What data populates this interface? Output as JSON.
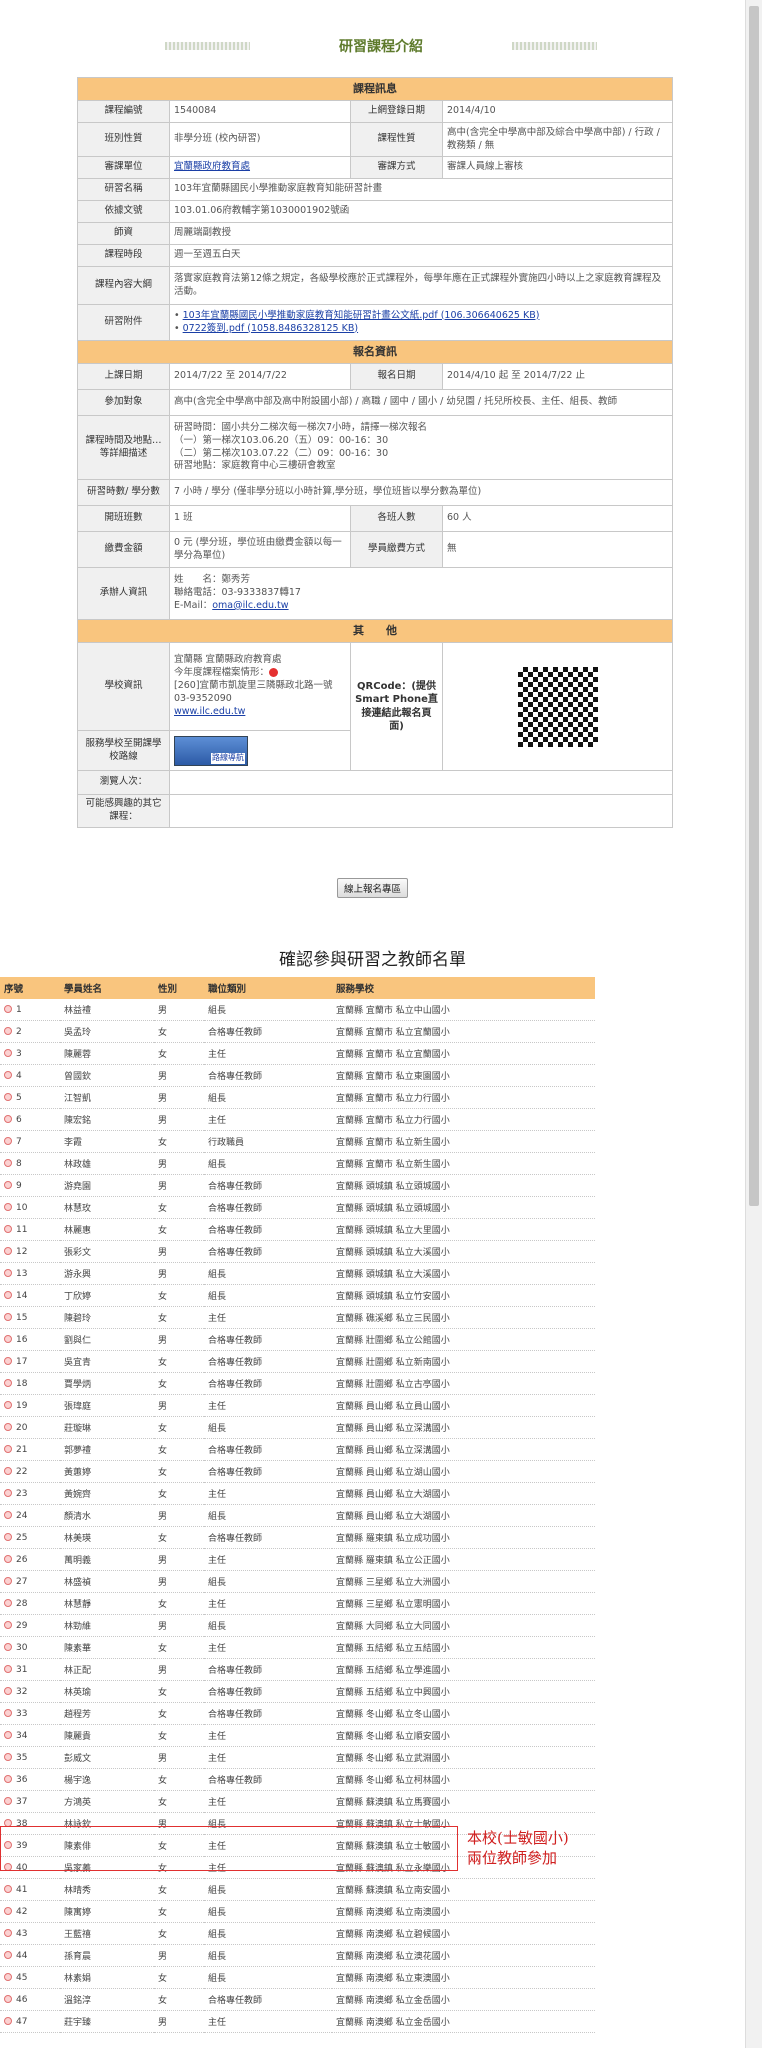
{
  "page": {
    "title": "研習課程介紹"
  },
  "sections": {
    "course": "課程訊息",
    "enroll": "報名資訊",
    "other": "其　　他"
  },
  "course": {
    "id_label": "課程編號",
    "id": "1540084",
    "listed_label": "上網登錄日期",
    "listed": "2014/4/10",
    "class_label": "班別性質",
    "class": "非學分班 (校內研習)",
    "nature_label": "課程性質",
    "nature": "高中(含完全中學高中部及綜合中學高中部) / 行政 / 教務類 / 無",
    "unit_label": "審課單位",
    "unit": "宜蘭縣政府教育處",
    "review_label": "審課方式",
    "review": "審課人員線上審核",
    "name_label": "研習名稱",
    "name": "103年宜蘭縣國民小學推動家庭教育知能研習計畫",
    "doc_label": "依據文號",
    "doc": "103.01.06府教輔字第1030001902號函",
    "teacher_label": "師資",
    "teacher": "周麗端副教授",
    "time_label": "課程時段",
    "time": "週一至週五白天",
    "content_label": "課程內容大綱",
    "content": "落實家庭教育法第12條之規定，各級學校應於正式課程外，每學年應在正式課程外實施四小時以上之家庭教育課程及活動。",
    "attach_label": "研習附件",
    "attachments": [
      "103年宜蘭縣國民小學推動家庭教育知能研習計畫公文紙.pdf (106.306640625 KB)",
      "0722簽到.pdf (1058.8486328125 KB)"
    ]
  },
  "enroll": {
    "date_label": "上課日期",
    "date": "2014/7/22 至 2014/7/22",
    "signup_label": "報名日期",
    "signup": "2014/4/10 起 至 2014/7/22 止",
    "target_label": "參加對象",
    "target": "高中(含完全中學高中部及高中附設國小部) / 高職 / 國中 / 國小 / 幼兒園 / 托兒所校長、主任、組長、教師",
    "place_label": "課程時間及地點…等詳細描述",
    "place_lines": [
      "研習時間：國小共分二梯次每一梯次7小時，請擇一梯次報名",
      "（一）第一梯次103.06.20（五）09：00-16：30",
      "（二）第二梯次103.07.22（二）09：00-16：30",
      "研習地點：家庭教育中心三樓研會教室"
    ],
    "hours_label": "研習時數/ 學分數",
    "hours": "7 小時 / 學分 (僅非學分班以小時計算,學分班，學位班皆以學分數為單位)",
    "classes_label": "開班班數",
    "classes": "1 班",
    "per_label": "各班人數",
    "per": "60 人",
    "fee_label": "繳費金額",
    "fee": "0 元 (學分班，學位班由繳費金額以每一學分為單位)",
    "pay_label": "學員繳費方式",
    "pay": "無",
    "contact_label": "承辦人資訊",
    "contact_name": "姓　　名：鄭秀芳",
    "contact_phone": "聯絡電話：03-9333837轉17",
    "contact_email_label": "E-Mail：",
    "contact_email": "oma@ilc.edu.tw"
  },
  "other": {
    "school_label": "學校資訊",
    "school_lines": [
      "宜蘭縣 宜蘭縣政府教育處",
      "今年度課程檔案情形："
    ],
    "school_addr": "[260]宜蘭市凱旋里三隣縣政北路一號",
    "school_phone": "03-9352090",
    "school_url": "www.ilc.edu.tw",
    "route_label": "服務學校至開課學校路線",
    "route_caption": "路線導航",
    "qr_label": "QRCode：(提供Smart Phone直接連結此報名頁面)",
    "viewers_label": "瀏覽人次：",
    "related_label": "可能感興趣的其它課程："
  },
  "button": {
    "online": "線上報名專區"
  },
  "list": {
    "title": "確認參與研習之教師名單",
    "headers": [
      "序號",
      "學員姓名",
      "性別",
      "職位類別",
      "服務學校"
    ],
    "rows": [
      [
        "1",
        "林益禮",
        "男",
        "組長",
        "宜蘭縣 宜蘭市 私立中山國小"
      ],
      [
        "2",
        "吳孟玲",
        "女",
        "合格專任教師",
        "宜蘭縣 宜蘭市 私立宜蘭國小"
      ],
      [
        "3",
        "陳麗蓉",
        "女",
        "主任",
        "宜蘭縣 宜蘭市 私立宜蘭國小"
      ],
      [
        "4",
        "曾國欽",
        "男",
        "合格專任教師",
        "宜蘭縣 宜蘭市 私立東園國小"
      ],
      [
        "5",
        "江智凱",
        "男",
        "組長",
        "宜蘭縣 宜蘭市 私立力行國小"
      ],
      [
        "6",
        "陳宏銘",
        "男",
        "主任",
        "宜蘭縣 宜蘭市 私立力行國小"
      ],
      [
        "7",
        "李霞",
        "女",
        "行政職員",
        "宜蘭縣 宜蘭市 私立新生國小"
      ],
      [
        "8",
        "林政雄",
        "男",
        "組長",
        "宜蘭縣 宜蘭市 私立新生國小"
      ],
      [
        "9",
        "游堯園",
        "男",
        "合格專任教師",
        "宜蘭縣 頭城鎮 私立頭城國小"
      ],
      [
        "10",
        "林慧玫",
        "女",
        "合格專任教師",
        "宜蘭縣 頭城鎮 私立頭城國小"
      ],
      [
        "11",
        "林麗惠",
        "女",
        "合格專任教師",
        "宜蘭縣 頭城鎮 私立大里國小"
      ],
      [
        "12",
        "張彩文",
        "男",
        "合格專任教師",
        "宜蘭縣 頭城鎮 私立大溪國小"
      ],
      [
        "13",
        "游永興",
        "男",
        "組長",
        "宜蘭縣 頭城鎮 私立大溪國小"
      ],
      [
        "14",
        "丁欣婷",
        "女",
        "組長",
        "宜蘭縣 頭城鎮 私立竹安國小"
      ],
      [
        "15",
        "陳碧玲",
        "女",
        "主任",
        "宜蘭縣 礁溪鄉 私立三民國小"
      ],
      [
        "16",
        "劉與仁",
        "男",
        "合格專任教師",
        "宜蘭縣 壯圍鄉 私立公館國小"
      ],
      [
        "17",
        "吳宜青",
        "女",
        "合格專任教師",
        "宜蘭縣 壯圍鄉 私立新南國小"
      ],
      [
        "18",
        "賈學炳",
        "女",
        "合格專任教師",
        "宜蘭縣 壯圍鄉 私立古亭國小"
      ],
      [
        "19",
        "張瑋庭",
        "男",
        "主任",
        "宜蘭縣 員山鄉 私立員山國小"
      ],
      [
        "20",
        "莊璇琳",
        "女",
        "組長",
        "宜蘭縣 員山鄉 私立深溝國小"
      ],
      [
        "21",
        "郭夢禮",
        "女",
        "合格專任教師",
        "宜蘭縣 員山鄉 私立深溝國小"
      ],
      [
        "22",
        "黃蕙婷",
        "女",
        "合格專任教師",
        "宜蘭縣 員山鄉 私立湖山國小"
      ],
      [
        "23",
        "黃婉齊",
        "女",
        "主任",
        "宜蘭縣 員山鄉 私立大湖國小"
      ],
      [
        "24",
        "顏清水",
        "男",
        "組長",
        "宜蘭縣 員山鄉 私立大湖國小"
      ],
      [
        "25",
        "林美瑛",
        "女",
        "合格專任教師",
        "宜蘭縣 羅東鎮 私立成功國小"
      ],
      [
        "26",
        "萬明義",
        "男",
        "主任",
        "宜蘭縣 羅東鎮 私立公正國小"
      ],
      [
        "27",
        "林盛禎",
        "男",
        "組長",
        "宜蘭縣 三星鄉 私立大洲國小"
      ],
      [
        "28",
        "林慧靜",
        "女",
        "主任",
        "宜蘭縣 三星鄉 私立憲明國小"
      ],
      [
        "29",
        "林勁維",
        "男",
        "組長",
        "宜蘭縣 大同鄉 私立大同國小"
      ],
      [
        "30",
        "陳素華",
        "女",
        "主任",
        "宜蘭縣 五結鄉 私立五結國小"
      ],
      [
        "31",
        "林正配",
        "男",
        "合格專任教師",
        "宜蘭縣 五結鄉 私立學進國小"
      ],
      [
        "32",
        "林英瑜",
        "女",
        "合格專任教師",
        "宜蘭縣 五結鄉 私立中興國小"
      ],
      [
        "33",
        "趙程芳",
        "女",
        "合格專任教師",
        "宜蘭縣 冬山鄉 私立冬山國小"
      ],
      [
        "34",
        "陳麗貴",
        "女",
        "主任",
        "宜蘭縣 冬山鄉 私立順安國小"
      ],
      [
        "35",
        "彭威文",
        "男",
        "主任",
        "宜蘭縣 冬山鄉 私立武淵國小"
      ],
      [
        "36",
        "楊宇逸",
        "女",
        "合格專任教師",
        "宜蘭縣 冬山鄉 私立柯林國小"
      ],
      [
        "37",
        "方鴻英",
        "女",
        "主任",
        "宜蘭縣 蘇澳鎮 私立馬賽國小"
      ],
      [
        "38",
        "林詠欽",
        "男",
        "組長",
        "宜蘭縣 蘇澳鎮 私立士敏國小"
      ],
      [
        "39",
        "陳素俳",
        "女",
        "主任",
        "宜蘭縣 蘇澳鎮 私立士敏國小"
      ],
      [
        "40",
        "吳家蓁",
        "女",
        "主任",
        "宜蘭縣 蘇澳鎮 私立永樂國小"
      ],
      [
        "41",
        "林晴秀",
        "女",
        "組長",
        "宜蘭縣 蘇澳鎮 私立南安國小"
      ],
      [
        "42",
        "陳寓婷",
        "女",
        "組長",
        "宜蘭縣 南澳鄉 私立南澳國小"
      ],
      [
        "43",
        "王藍禧",
        "女",
        "組長",
        "宜蘭縣 南澳鄉 私立碧候國小"
      ],
      [
        "44",
        "孫育晨",
        "男",
        "組長",
        "宜蘭縣 南澳鄉 私立澳花國小"
      ],
      [
        "45",
        "林素娟",
        "女",
        "組長",
        "宜蘭縣 南澳鄉 私立東澳國小"
      ],
      [
        "46",
        "溫銘淳",
        "女",
        "合格專任教師",
        "宜蘭縣 南澳鄉 私立金岳國小"
      ],
      [
        "47",
        "莊宇臻",
        "男",
        "主任",
        "宜蘭縣 南澳鄉 私立金岳國小"
      ]
    ]
  },
  "annotation": {
    "line1": "本校(士敏國小)",
    "line2": "兩位教師參加"
  }
}
